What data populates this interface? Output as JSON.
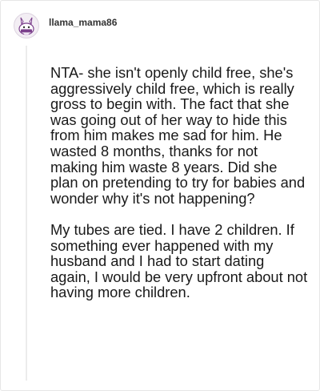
{
  "comment": {
    "author": "llama_mama86",
    "avatar_icon": "llama-avatar-icon",
    "paragraphs": [
      "NTA- she isn't openly child free, she's aggressively child free, which is really gross to begin with. The fact that she was going out of her way to hide this from him makes me sad for him. He wasted 8 months, thanks for not making him waste 8 years. Did she plan on pretending to try for babies and wonder why it's not happening?",
      "My tubes are tied. I have 2 children. If something ever happened with my husband and I had to start dating again, I would be very upfront about not having more children."
    ]
  },
  "colors": {
    "text": "#1a1a1a",
    "username": "#333333",
    "avatar_accent": "#7b3f8c",
    "thread_line": "#ececec"
  }
}
